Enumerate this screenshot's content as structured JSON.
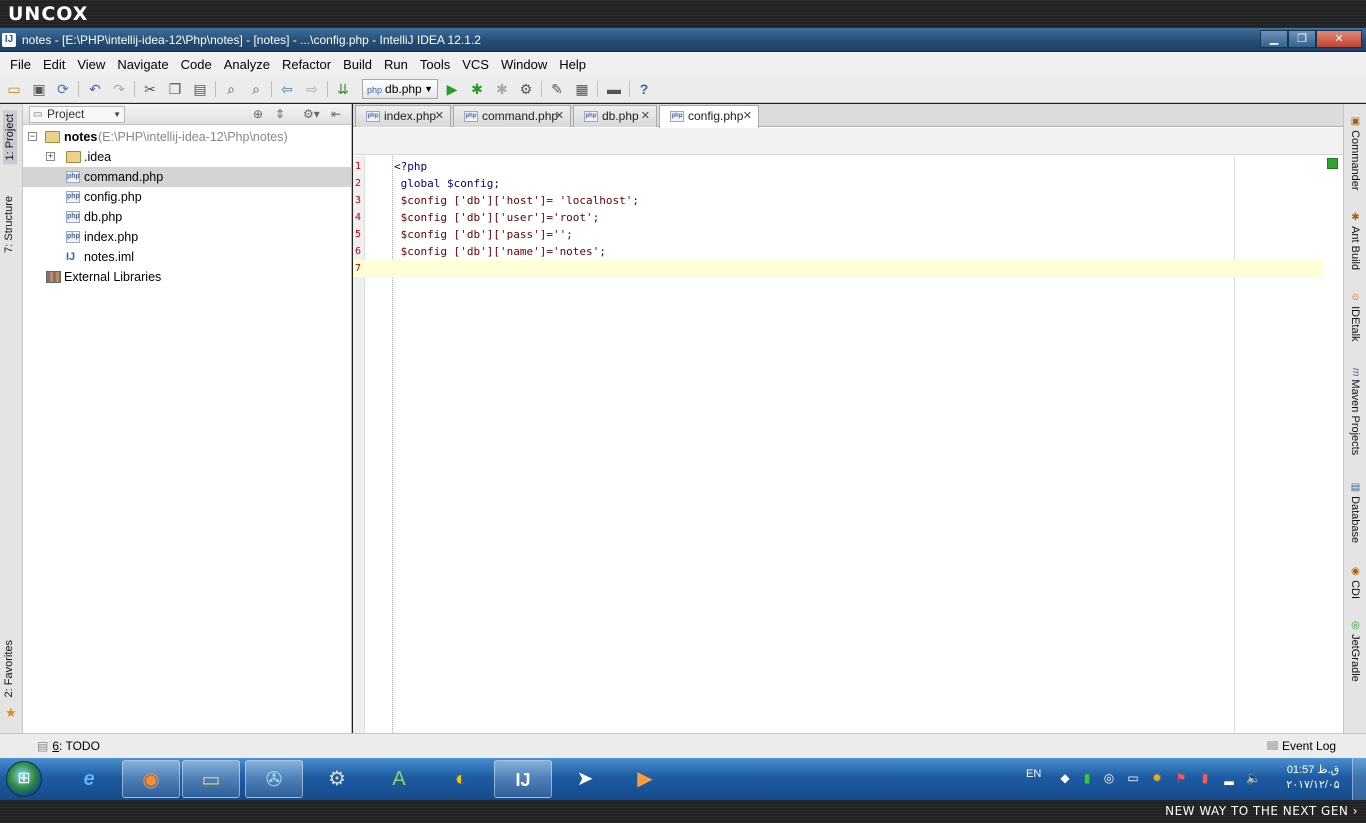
{
  "overlay": {
    "brand": "UNCOX",
    "tagline": "NEW WAY TO THE NEXT GEN ›"
  },
  "window": {
    "title": "notes - [E:\\PHP\\intellij-idea-12\\Php\\notes] - [notes] - ...\\config.php - IntelliJ IDEA 12.1.2",
    "app_icon": "intellij-icon",
    "minimize": "▁",
    "maximize": "❐",
    "close": "✕"
  },
  "menu": [
    "File",
    "Edit",
    "View",
    "Navigate",
    "Code",
    "Analyze",
    "Refactor",
    "Build",
    "Run",
    "Tools",
    "VCS",
    "Window",
    "Help"
  ],
  "toolbar": {
    "run_config": "db.php",
    "icons": [
      "open-icon",
      "save-icon",
      "sync-icon",
      "undo-icon",
      "redo-icon",
      "cut-icon",
      "copy-icon",
      "paste-icon",
      "find-icon",
      "replace-icon",
      "back-icon",
      "forward-icon",
      "make-icon",
      "run-icon",
      "debug-icon",
      "coverage-icon",
      "profile-icon",
      "settings-icon",
      "structure-icon",
      "sdk-icon",
      "help-icon"
    ]
  },
  "left_tabs": {
    "project": "1: Project",
    "structure": "7: Structure",
    "favorites": "2: Favorites"
  },
  "right_tabs": [
    "Commander",
    "Ant Build",
    "IDEtalk",
    "Maven Projects",
    "Database",
    "CDI",
    "JetGradle"
  ],
  "project": {
    "selector": "Project",
    "tree": [
      {
        "label": "notes",
        "path": "(E:\\PHP\\intellij-idea-12\\Php\\notes)",
        "type": "folder",
        "root": true
      },
      {
        "label": ".idea",
        "type": "folder"
      },
      {
        "label": "command.php",
        "type": "php",
        "selected": true
      },
      {
        "label": "config.php",
        "type": "php"
      },
      {
        "label": "db.php",
        "type": "php"
      },
      {
        "label": "index.php",
        "type": "php"
      },
      {
        "label": "notes.iml",
        "type": "iml"
      },
      {
        "label": "External Libraries",
        "type": "lib"
      }
    ]
  },
  "tabs": [
    {
      "label": "index.php",
      "active": false
    },
    {
      "label": "command.php",
      "active": false
    },
    {
      "label": "db.php",
      "active": false
    },
    {
      "label": "config.php",
      "active": true
    }
  ],
  "code": {
    "lines": [
      "<?php",
      " global $config;",
      " $config ['db']['host']= 'localhost';",
      " $config ['db']['user']='root';",
      " $config ['db']['pass']='';",
      " $config ['db']['name']='notes';",
      ""
    ],
    "current_line": 7
  },
  "status": {
    "todo_num": "6",
    "todo_label": ": TODO",
    "event_log": "Event Log"
  },
  "taskbar": {
    "apps": [
      "ie-icon",
      "firefox-icon",
      "explorer-icon",
      "media-center-icon",
      "utility-icon",
      "android-studio-icon",
      "browser-icon",
      "intellij-icon",
      "telegram-icon",
      "video-player-icon"
    ],
    "lang": "EN",
    "time": "01:57 ق.ظ",
    "date": "۲۰۱۷/۱۲/۰۵"
  }
}
